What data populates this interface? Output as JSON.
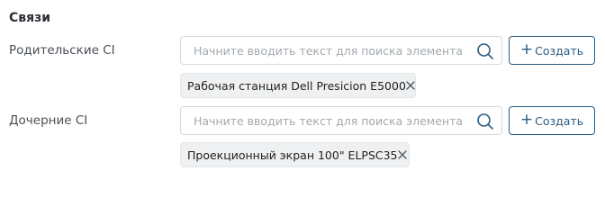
{
  "section": {
    "title": "Связи"
  },
  "parent": {
    "label": "Родительские CI",
    "search_placeholder": "Начните вводить текст для поиска элемента",
    "create_label": "Создать",
    "chips": [
      "Рабочая станция Dell Presicion E5000"
    ]
  },
  "child": {
    "label": "Дочерние CI",
    "search_placeholder": "Начните вводить текст для поиска элемента",
    "create_label": "Создать",
    "chips": [
      "Проекционный экран 100\" ELPSC35"
    ]
  },
  "icons": {
    "search": "search-icon",
    "plus": "plus-icon",
    "close": "close-icon"
  },
  "colors": {
    "accent": "#2b5c80",
    "chip_bg": "#eef0f2",
    "border": "#d5d9dd"
  }
}
